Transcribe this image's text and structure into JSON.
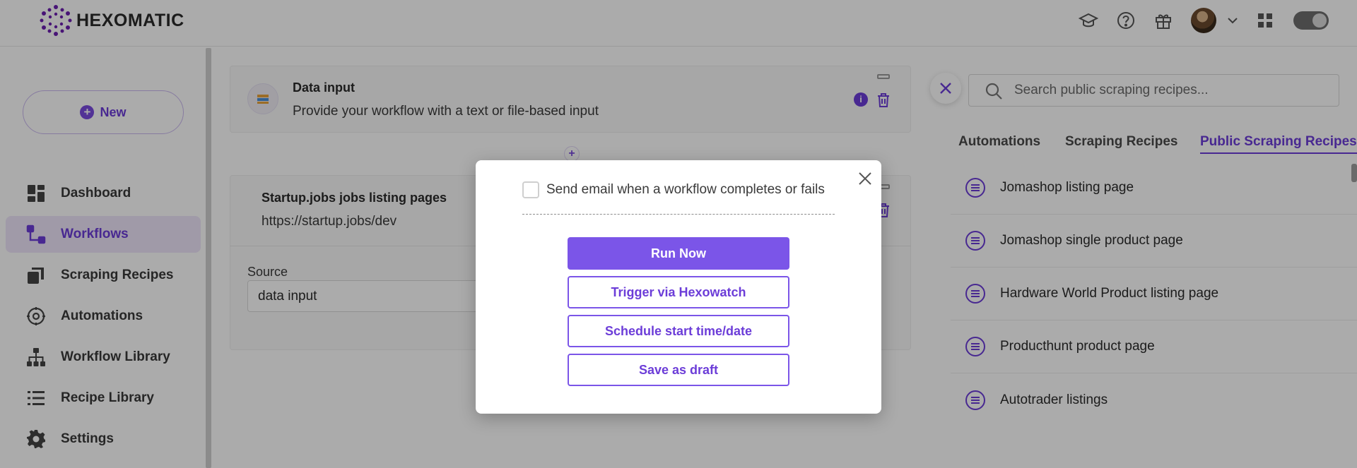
{
  "header": {
    "logo_text": "HEXOMATIC",
    "icons": [
      "graduation-cap-icon",
      "help-icon",
      "gift-icon",
      "avatar",
      "chevron-down-icon",
      "apps-grid-icon",
      "theme-toggle"
    ]
  },
  "sidebar": {
    "new_label": "New",
    "items": [
      {
        "label": "Dashboard",
        "icon": "dashboard-icon"
      },
      {
        "label": "Workflows",
        "icon": "workflow-icon",
        "active": true
      },
      {
        "label": "Scraping Recipes",
        "icon": "scraping-recipes-icon"
      },
      {
        "label": "Automations",
        "icon": "automations-icon"
      },
      {
        "label": "Workflow Library",
        "icon": "workflow-library-icon"
      },
      {
        "label": "Recipe Library",
        "icon": "recipe-library-icon"
      },
      {
        "label": "Settings",
        "icon": "gear-icon"
      }
    ]
  },
  "workflow": {
    "data_input": {
      "title": "Data input",
      "description": "Provide your workflow with a text or file-based input"
    },
    "startup_node": {
      "title": "Startup.jobs jobs listing pages",
      "url": "https://startup.jobs/dev"
    },
    "source": {
      "label": "Source",
      "value": "data input"
    }
  },
  "right_panel": {
    "search_placeholder": "Search public scraping recipes...",
    "tabs": [
      "Automations",
      "Scraping Recipes",
      "Public Scraping Recipes"
    ],
    "active_tab": "Public Scraping Recipes",
    "recipes": [
      "Jomashop listing page",
      "Jomashop single product page",
      "Hardware World Product listing page",
      "Producthunt product page",
      "Autotrader listings"
    ]
  },
  "modal": {
    "checkbox_label": "Send email when a workflow completes or fails",
    "checkbox_checked": false,
    "buttons": {
      "run_now": "Run Now",
      "trigger": "Trigger via Hexowatch",
      "schedule": "Schedule start time/date",
      "draft": "Save as draft"
    }
  },
  "colors": {
    "accent": "#6c3dd8",
    "button_primary": "#7b55e8",
    "active_nav_bg": "#efe6fb"
  }
}
